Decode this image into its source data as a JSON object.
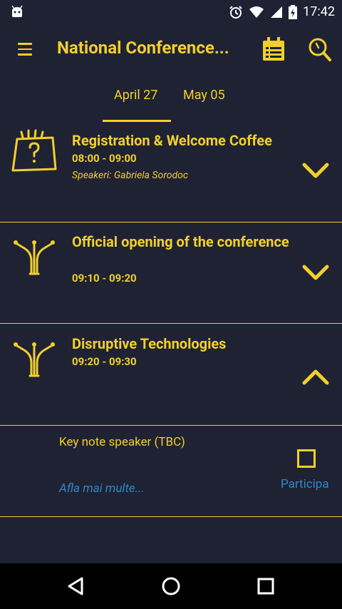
{
  "status_bar": {
    "time": "17:42",
    "icons": [
      "android-icon",
      "alarm-icon",
      "wifi-icon",
      "signal-icon",
      "battery-icon"
    ]
  },
  "app_bar": {
    "title": "National Conference...",
    "icons": [
      "menu-icon",
      "calendar-icon",
      "search-icon"
    ]
  },
  "tabs": [
    {
      "label": "April 27",
      "selected": true
    },
    {
      "label": "May 05",
      "selected": false
    }
  ],
  "sessions": [
    {
      "title": "Registration & Welcome Coffee",
      "time": "08:00 - 09:00",
      "speakers": "Speakeri: Gabriela Sorodoc",
      "icon": "question-board-icon",
      "expanded": false
    },
    {
      "title": "Official opening of the conference",
      "time": "09:10 - 09:20",
      "speakers": "",
      "icon": "branching-icon",
      "expanded": false
    },
    {
      "title": "Disruptive Technologies",
      "time": "09:20 - 09:30",
      "speakers": "",
      "icon": "branching-icon",
      "expanded": true
    }
  ],
  "expanded_detail": {
    "description": "Key note speaker (TBC)",
    "more_link": "Afla mai multe...",
    "participate_label": "Participa",
    "participate_checked": false
  },
  "colors": {
    "background": "#1e2233",
    "accent": "#f2cf2b",
    "link": "#2f88c6",
    "navbar": "#000000"
  }
}
